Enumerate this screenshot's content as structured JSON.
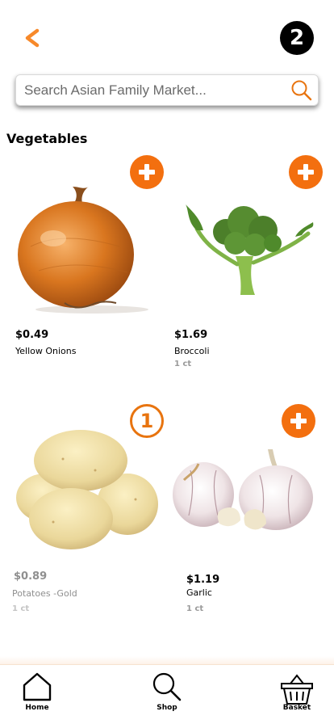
{
  "header": {
    "back_icon": "chevron-left-icon",
    "cart_count": "2"
  },
  "search": {
    "placeholder": "Search Asian Family Market...",
    "icon": "search-icon"
  },
  "section": {
    "title": "Vegetables"
  },
  "products": [
    {
      "price": "$0.49",
      "name": "Yellow Onions",
      "unit": "",
      "in_cart": "",
      "image": "onion"
    },
    {
      "price": "$1.69",
      "name": "Broccoli",
      "unit": "1 ct",
      "in_cart": "",
      "image": "broccoli"
    },
    {
      "price": "$0.89",
      "name": "Potatoes -Gold",
      "unit": "1 ct",
      "in_cart": "1",
      "image": "potatoes"
    },
    {
      "price": "$1.19",
      "name": "Garlic",
      "unit": "1 ct",
      "in_cart": "",
      "image": "garlic"
    }
  ],
  "nav": {
    "home": "Home",
    "shop": "Shop",
    "basket": "Basket"
  },
  "colors": {
    "accent": "#f36f0f",
    "badge": "#000000"
  }
}
